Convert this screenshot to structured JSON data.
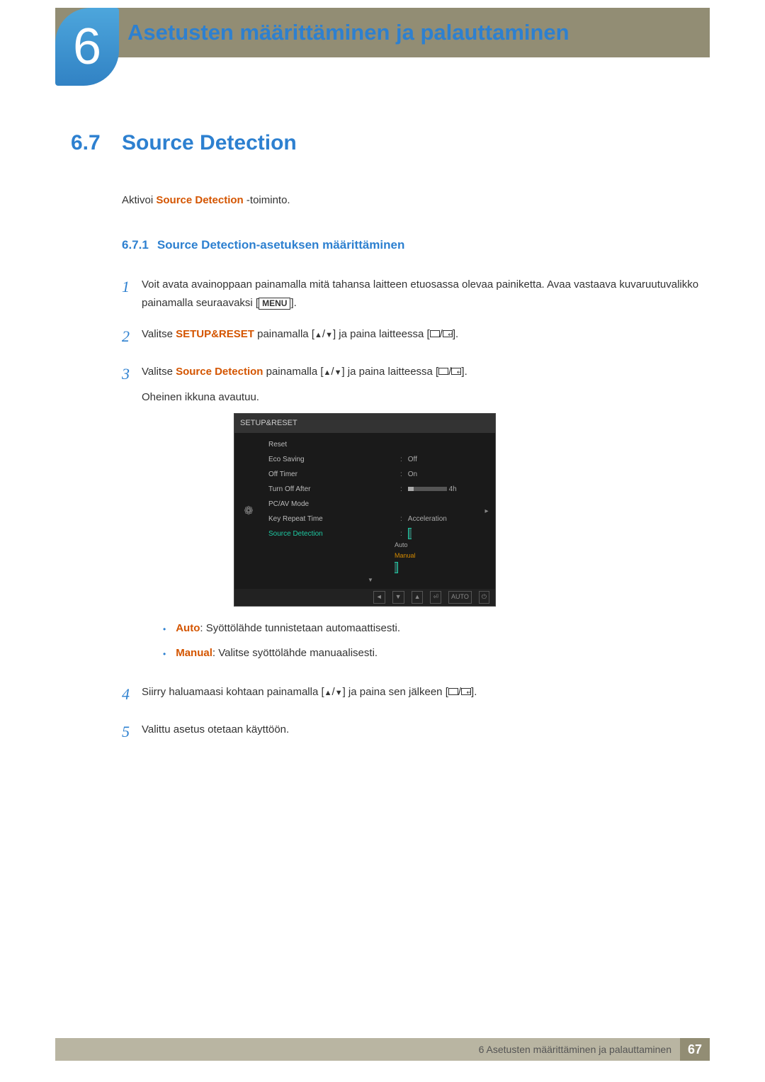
{
  "chapter": {
    "number": "6",
    "title": "Asetusten määrittäminen ja palauttaminen"
  },
  "section": {
    "number": "6.7",
    "title": "Source Detection"
  },
  "intro": {
    "prefix": "Aktivoi ",
    "highlight": "Source Detection",
    "suffix": " -toiminto."
  },
  "subsection": {
    "number": "6.7.1",
    "title": "Source Detection-asetuksen määrittäminen"
  },
  "steps": {
    "s1": {
      "num": "1",
      "text": "Voit avata avainoppaan painamalla mitä tahansa laitteen etuosassa olevaa painiketta. Avaa vastaava kuvaruutuvalikko painamalla seuraavaksi [",
      "menu": "MENU",
      "after": "]."
    },
    "s2": {
      "num": "2",
      "prefix": "Valitse ",
      "highlight": "SETUP&RESET",
      "middle": " painamalla [",
      "sep": "/",
      "after1": "] ja paina laitteessa [",
      "sep2": "/",
      "after2": "]."
    },
    "s3": {
      "num": "3",
      "prefix": "Valitse ",
      "highlight": "Source Detection",
      "middle": " painamalla [",
      "sep": "/",
      "after1": "] ja paina laitteessa [",
      "sep2": "/",
      "after2": "].",
      "trailing": "Oheinen ikkuna avautuu."
    },
    "s4": {
      "num": "4",
      "text": "Siirry haluamaasi kohtaan painamalla [",
      "sep": "/",
      "after1": "] ja paina sen jälkeen [",
      "sep2": "/",
      "after2": "]."
    },
    "s5": {
      "num": "5",
      "text": "Valittu asetus otetaan käyttöön."
    }
  },
  "osd": {
    "title": "SETUP&RESET",
    "rows": {
      "reset": "Reset",
      "eco": "Eco Saving",
      "eco_val": "Off",
      "offtimer": "Off Timer",
      "offtimer_val": "On",
      "turnoff": "Turn Off After",
      "turnoff_val": "4h",
      "pcav": "PC/AV Mode",
      "keyrepeat": "Key Repeat Time",
      "keyrepeat_val": "Acceleration",
      "sourcedet": "Source Detection",
      "auto": "Auto",
      "manual": "Manual"
    },
    "footer": {
      "b1": "◄",
      "b2": "▼",
      "b3": "▲",
      "b4": "⏎",
      "b5": "AUTO",
      "b6": "⏻"
    }
  },
  "bullets": {
    "auto_label": "Auto",
    "auto_text": ": Syöttölähde tunnistetaan automaattisesti.",
    "manual_label": "Manual",
    "manual_text": ": Valitse syöttölähde manuaalisesti."
  },
  "footer": {
    "text": "6 Asetusten määrittäminen ja palauttaminen",
    "page": "67"
  }
}
